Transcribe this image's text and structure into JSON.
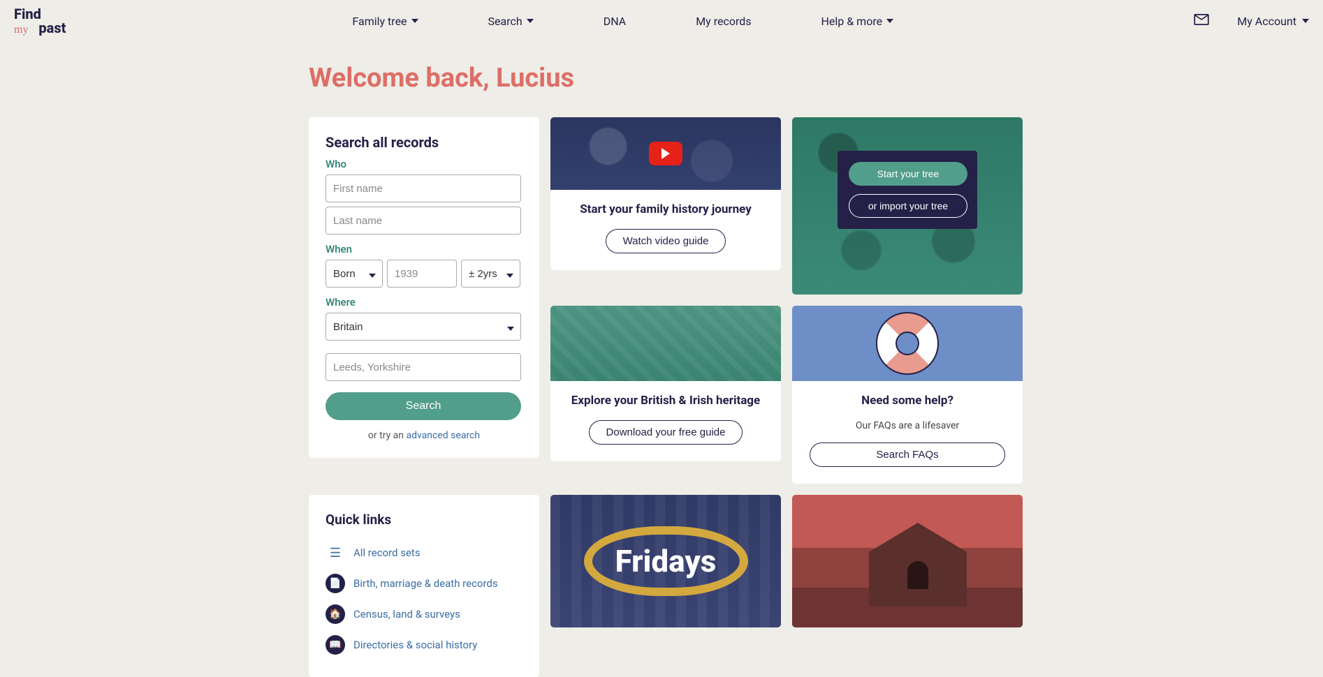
{
  "logo": {
    "find": "Find",
    "my": "my",
    "past": "past"
  },
  "nav": {
    "family_tree": "Family tree",
    "search": "Search",
    "dna": "DNA",
    "my_records": "My records",
    "help": "Help & more"
  },
  "account": {
    "label": "My Account"
  },
  "welcome": "Welcome back, Lucius",
  "search_card": {
    "title": "Search all records",
    "who_label": "Who",
    "first_name_placeholder": "First name",
    "last_name_placeholder": "Last name",
    "when_label": "When",
    "born_option": "Born",
    "year_placeholder": "1939",
    "tolerance_option": "± 2yrs",
    "where_label": "Where",
    "country_option": "Britain",
    "location_placeholder": "Leeds, Yorkshire",
    "search_button": "Search",
    "or_try": "or try an ",
    "advanced_link": "advanced search"
  },
  "video_card": {
    "title": "Start your family history journey",
    "button": "Watch video guide"
  },
  "tree_card": {
    "start": "Start your tree",
    "import": "or import your tree"
  },
  "map_card": {
    "title": "Explore your British & Irish heritage",
    "button": "Download your free guide"
  },
  "faq_card": {
    "title": "Need some help?",
    "subtitle": "Our FAQs are a lifesaver",
    "button": "Search FAQs"
  },
  "quick": {
    "title": "Quick links",
    "all": "All record sets",
    "bmd": "Birth, marriage & death records",
    "census": "Census, land & surveys",
    "directories": "Directories & social history"
  },
  "fridays": {
    "label": "Fridays"
  }
}
